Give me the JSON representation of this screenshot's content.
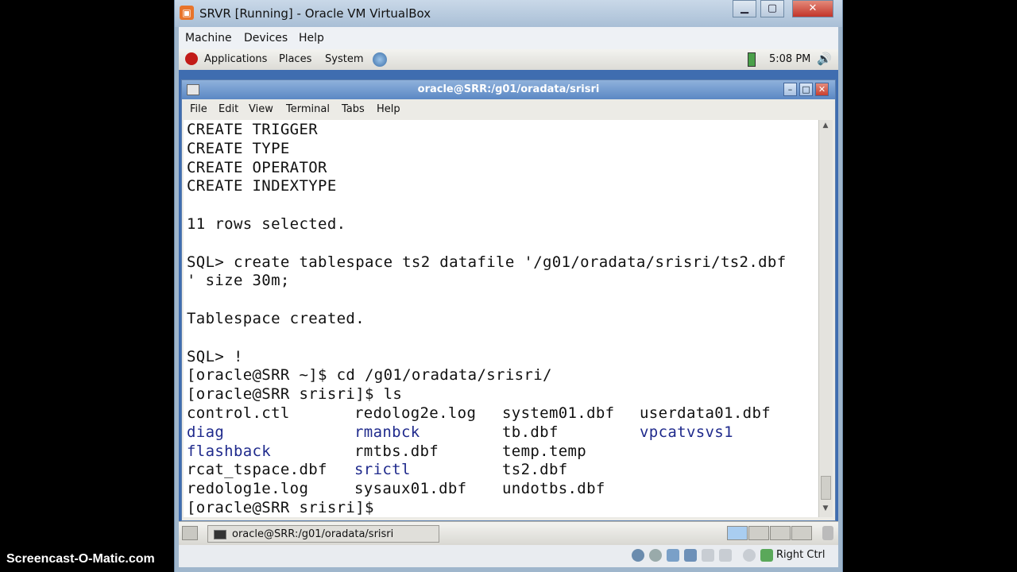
{
  "vbox": {
    "title": "SRVR [Running] - Oracle VM VirtualBox",
    "menu": [
      "Machine",
      "Devices",
      "Help"
    ],
    "status_hostkey": "Right Ctrl"
  },
  "guest_panel": {
    "items": [
      "Applications",
      "Places",
      "System"
    ],
    "clock": "5:08 PM"
  },
  "terminal": {
    "title": "oracle@SRR:/g01/oradata/srisri",
    "menu": [
      "File",
      "Edit",
      "View",
      "Terminal",
      "Tabs",
      "Help"
    ],
    "lines": [
      "CREATE TRIGGER",
      "CREATE TYPE",
      "CREATE OPERATOR",
      "CREATE INDEXTYPE",
      "",
      "11 rows selected.",
      "",
      "SQL> create tablespace ts2 datafile '/g01/oradata/srisri/ts2.dbf",
      "' size 30m;",
      "",
      "Tablespace created.",
      "",
      "SQL> !",
      "[oracle@SRR ~]$ cd /g01/oradata/srisri/",
      "[oracle@SRR srisri]$ ls"
    ],
    "ls_rows": [
      [
        {
          "t": "control.ctl",
          "dir": false
        },
        {
          "t": "redolog2e.log",
          "dir": false
        },
        {
          "t": "system01.dbf",
          "dir": false
        },
        {
          "t": "userdata01.dbf",
          "dir": false
        }
      ],
      [
        {
          "t": "diag",
          "dir": true
        },
        {
          "t": "rmanbck",
          "dir": true
        },
        {
          "t": "tb.dbf",
          "dir": false
        },
        {
          "t": "vpcatvsvs1",
          "dir": true
        }
      ],
      [
        {
          "t": "flashback",
          "dir": true
        },
        {
          "t": "rmtbs.dbf",
          "dir": false
        },
        {
          "t": "temp.temp",
          "dir": false
        },
        {
          "t": "",
          "dir": false
        }
      ],
      [
        {
          "t": "rcat_tspace.dbf",
          "dir": false
        },
        {
          "t": "srictl",
          "dir": true
        },
        {
          "t": "ts2.dbf",
          "dir": false
        },
        {
          "t": "",
          "dir": false
        }
      ],
      [
        {
          "t": "redolog1e.log",
          "dir": false
        },
        {
          "t": "sysaux01.dbf",
          "dir": false
        },
        {
          "t": "undotbs.dbf",
          "dir": false
        },
        {
          "t": "",
          "dir": false
        }
      ]
    ],
    "prompt": "[oracle@SRR srisri]$ "
  },
  "taskbar": {
    "task_label": "oracle@SRR:/g01/oradata/srisri"
  },
  "watermark": "Screencast-O-Matic.com",
  "colors": {
    "dir_blue": "#1f2a8c",
    "guest_bg": "#3f6db0"
  }
}
